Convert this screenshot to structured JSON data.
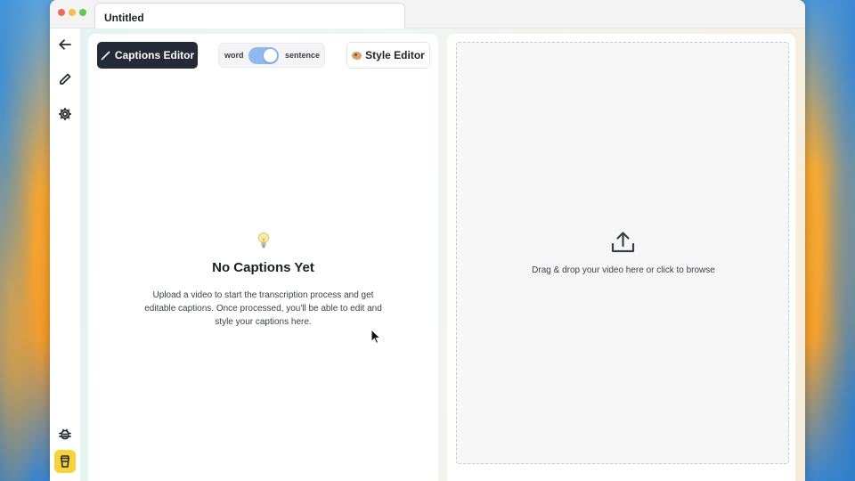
{
  "window": {
    "tab_title": "Untitled"
  },
  "sidebar": {
    "items": [
      {
        "name": "back",
        "icon": "arrow-left-icon"
      },
      {
        "name": "edit",
        "icon": "pencil-icon"
      },
      {
        "name": "settings",
        "icon": "gear-icon"
      },
      {
        "name": "debug",
        "icon": "bug-icon"
      },
      {
        "name": "support",
        "icon": "coffee-cup-icon",
        "color": "#f7d23a"
      }
    ]
  },
  "editor": {
    "captions_button": "Captions Editor",
    "toggle": {
      "left_label": "word",
      "right_label": "sentence",
      "selected": "sentence"
    },
    "style_button": "Style Editor",
    "empty_state": {
      "icon": "lightbulb-icon",
      "title": "No Captions Yet",
      "description": "Upload a video to start the transcription process and get editable captions. Once processed, you'll be able to edit and style your captions here."
    }
  },
  "dropzone": {
    "icon": "upload-icon",
    "text": "Drag & drop your video here or click to browse"
  },
  "colors": {
    "primary_dark": "#252b36",
    "toggle_on": "#8fb8ee",
    "accent_yellow": "#f7d23a"
  }
}
